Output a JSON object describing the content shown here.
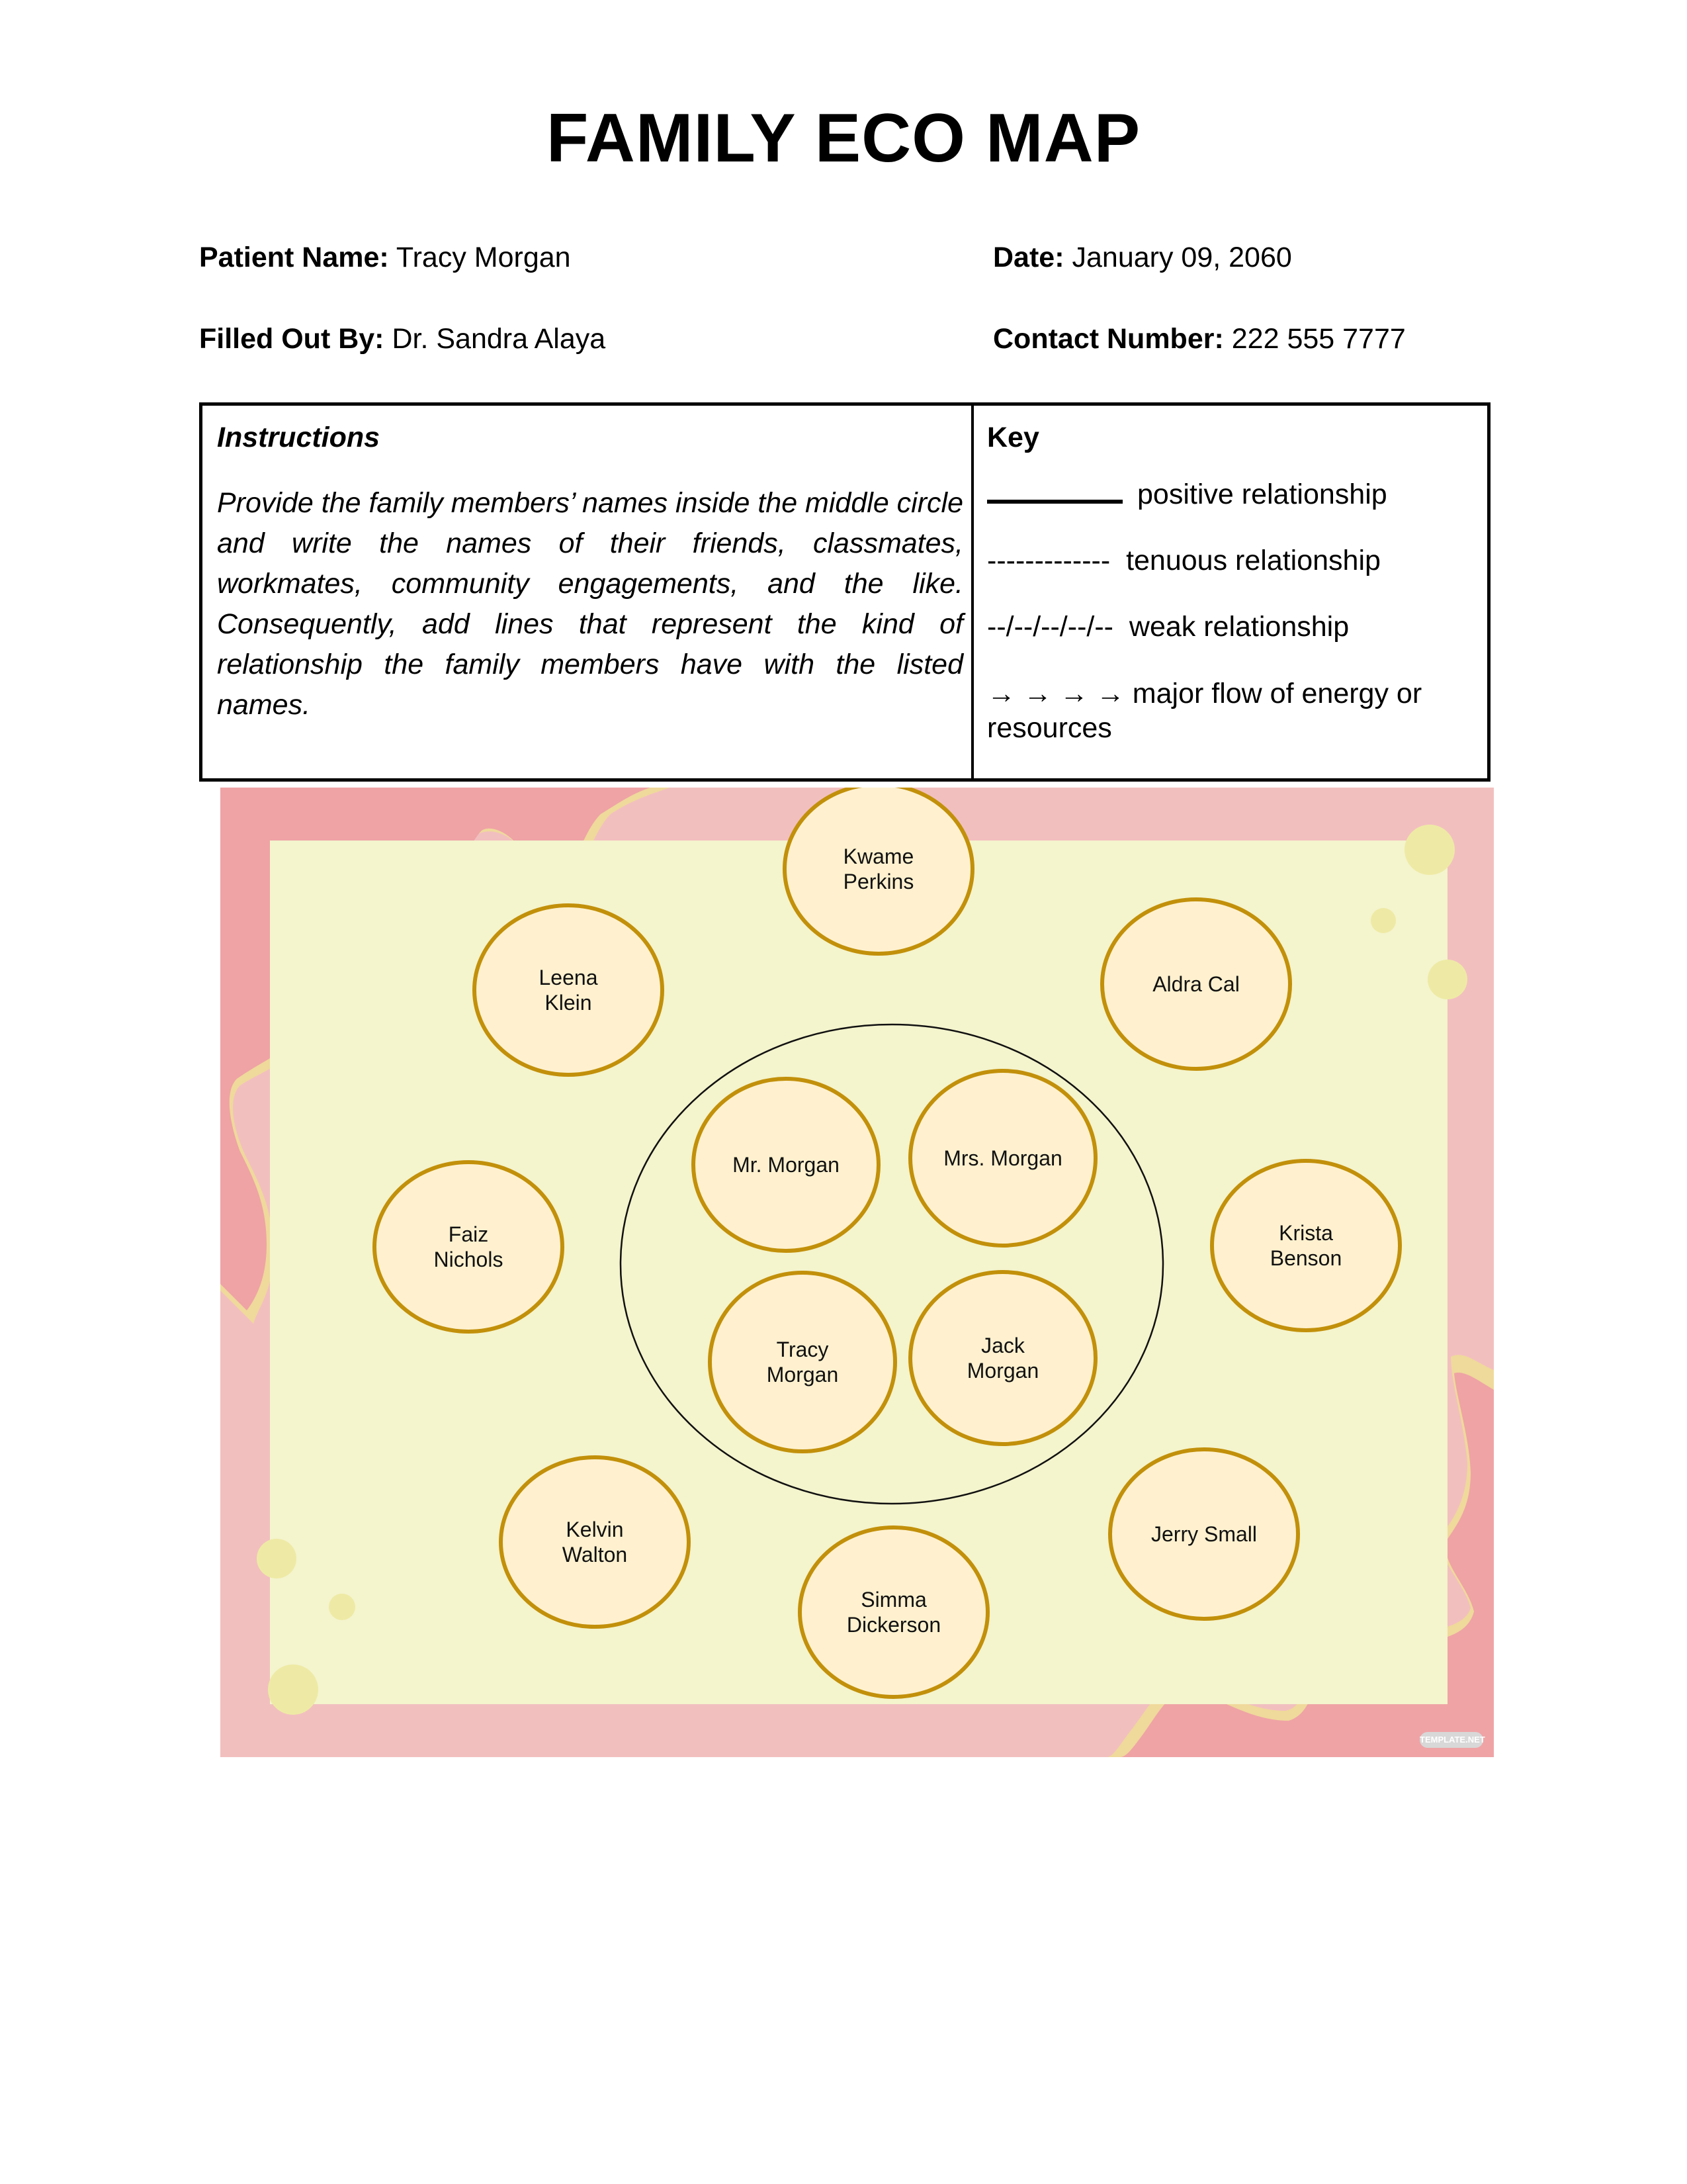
{
  "title": "FAMILY ECO MAP",
  "fields": {
    "patient_name": {
      "label": "Patient Name:",
      "value": "Tracy Morgan"
    },
    "date": {
      "label": "Date:",
      "value": "January 09, 2060"
    },
    "filled_out_by": {
      "label": "Filled Out By:",
      "value": "Dr. Sandra Alaya"
    },
    "contact_number": {
      "label": "Contact Number:",
      "value": "222 555 7777"
    }
  },
  "instructions": {
    "heading": "Instructions",
    "body": "Provide the family members’ names inside the middle circle and write the names of their friends, classmates, workmates, community engagements, and the like. Consequently, add lines that represent the kind of relationship the family members have with the listed names."
  },
  "key": {
    "heading": "Key",
    "items": [
      {
        "symbol": "",
        "label": "positive relationship"
      },
      {
        "symbol": "-------------",
        "label": "tenuous relationship"
      },
      {
        "symbol": "--/--/--/--/--",
        "label": "weak relationship"
      },
      {
        "symbol": "→ → → →",
        "label": "major flow of energy or resources"
      }
    ]
  },
  "eco_map": {
    "family_members": [
      "Mr. Morgan",
      "Mrs. Morgan",
      "Tracy Morgan",
      "Jack Morgan"
    ],
    "external_contacts": [
      "Kwame Perkins",
      "Leena Klein",
      "Aldra Cal",
      "Faiz Nichols",
      "Krista Benson",
      "Kelvin Walton",
      "Jerry Small",
      "Simma Dickerson"
    ],
    "colors": {
      "frame_pink": "#f2bfbf",
      "wave_pink": "#efa3a5",
      "wave_cream": "#efd99b",
      "canvas": "#f4f4cd",
      "node_fill": "#fff1cf",
      "node_stroke": "#c2900a",
      "dots": "#eeeaa5"
    }
  },
  "watermark": "TEMPLATE.NET"
}
